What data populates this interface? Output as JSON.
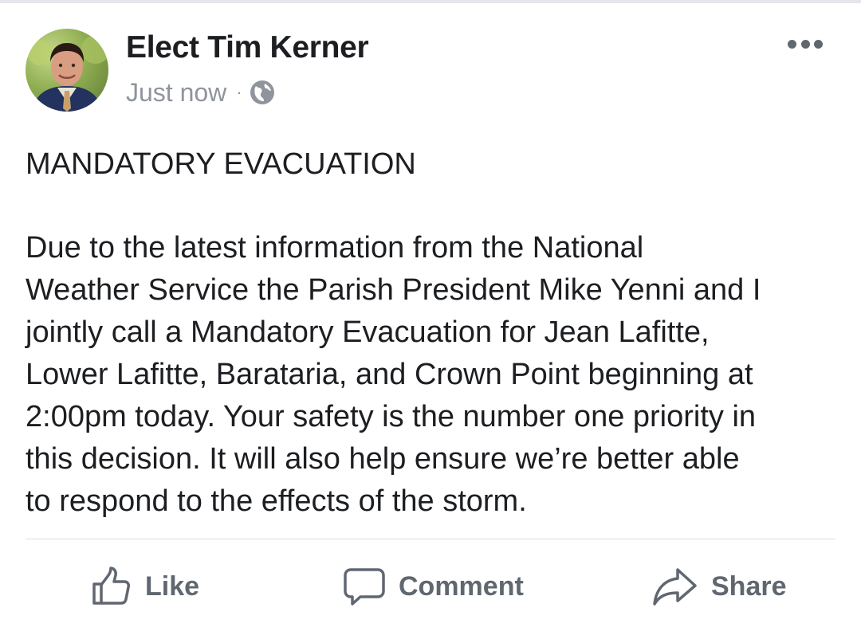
{
  "post": {
    "author": "Elect Tim Kerner",
    "timestamp": "Just now",
    "separator": "·",
    "audience_icon": "globe-icon",
    "headline": "MANDATORY EVACUATION",
    "message_lines": [
      "Due to the latest information from the National",
      "Weather Service the Parish President Mike Yenni and I",
      "jointly call a Mandatory Evacuation for Jean Lafitte,",
      "Lower Lafitte, Barataria, and Crown Point beginning at",
      "2:00pm today. Your safety is the number one priority in",
      "this decision. It will also help ensure we’re better able",
      "to respond to the effects of the storm."
    ]
  },
  "actions": {
    "like": {
      "label": "Like",
      "icon": "thumbs-up-icon"
    },
    "comment": {
      "label": "Comment",
      "icon": "speech-bubble-icon"
    },
    "share": {
      "label": "Share",
      "icon": "share-arrow-icon"
    }
  },
  "colors": {
    "text_primary": "#1c1e21",
    "text_secondary": "#90949c",
    "action_gray": "#606770",
    "divider": "#dadde1"
  }
}
